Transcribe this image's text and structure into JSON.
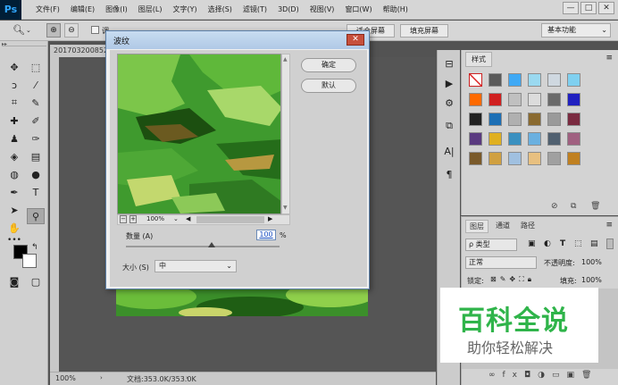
{
  "app": {
    "logo": "Ps"
  },
  "menu": [
    "文件(F)",
    "编辑(E)",
    "图像(I)",
    "图层(L)",
    "文字(Y)",
    "选择(S)",
    "滤镜(T)",
    "3D(D)",
    "视图(V)",
    "窗口(W)",
    "帮助(H)"
  ],
  "window_controls": {
    "minimize": "—",
    "maximize": "□",
    "close": "✕"
  },
  "options": {
    "fill_screen_btn": "填充屏幕",
    "fit_screen_partial": "适合屏幕",
    "workspace": "基本功能",
    "checkbox_label": "调"
  },
  "document": {
    "tab": "201703200852",
    "zoom": "100%",
    "doc_info": "文档:353.0K/353.0K"
  },
  "dialog": {
    "title": "波纹",
    "ok": "确定",
    "default": "默认",
    "zoom": "100%",
    "amount_label": "数量 (A)",
    "amount_value": "100",
    "amount_unit": "%",
    "amount_fraction": 0.56,
    "size_label": "大小 (S)",
    "size_value": "中"
  },
  "styles_panel": {
    "tab": "样式"
  },
  "layers_panel": {
    "tabs": [
      "图层",
      "通道",
      "路径"
    ],
    "filter": "ρ 类型",
    "blend_mode": "正常",
    "opacity_label": "不透明度:",
    "opacity_value": "100%",
    "lock_label": "锁定:",
    "fill_label": "填充:",
    "fill_value": "100%"
  },
  "watermark": {
    "title": "百科全说",
    "subtitle": "助你轻松解决"
  },
  "colors": {
    "accent": "#31a8ff",
    "dialog_border": "#5c7fa7",
    "watermark_green": "#2fb44a"
  }
}
